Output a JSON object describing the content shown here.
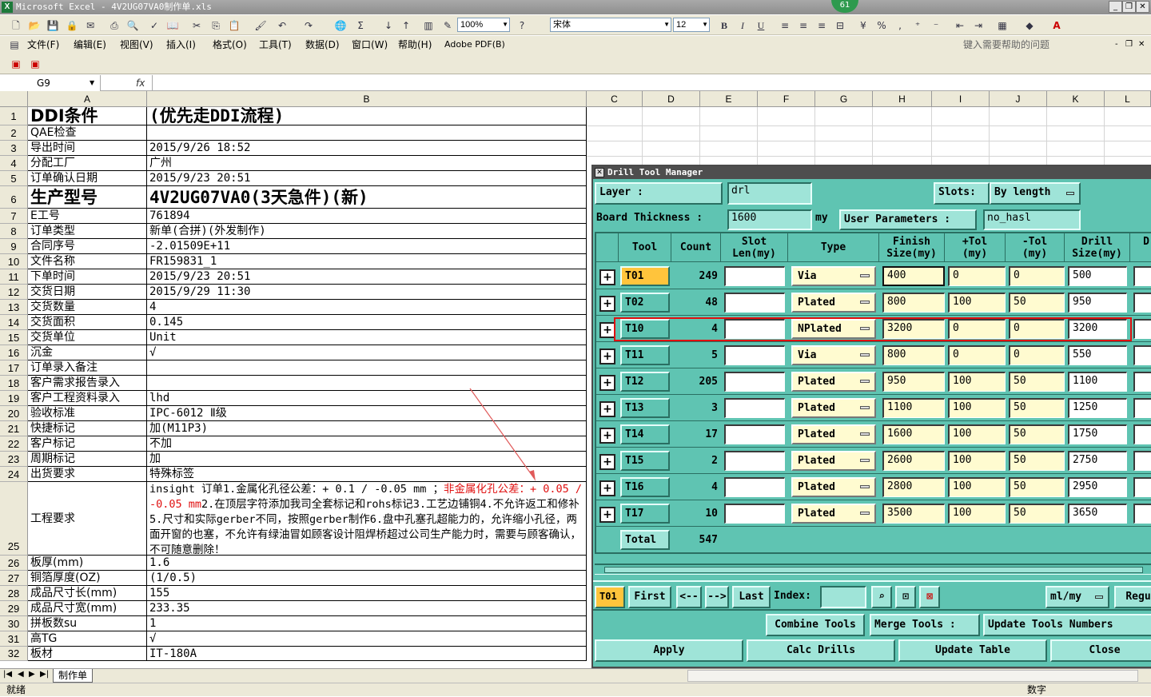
{
  "app": {
    "title": "Microsoft Excel - 4V2UG07VA0制作单.xls",
    "notification_count": "61"
  },
  "toolbar": {
    "zoom": "100%",
    "font_name": "宋体",
    "font_size": "12"
  },
  "menu": {
    "items": [
      "文件(F)",
      "编辑(E)",
      "视图(V)",
      "插入(I)",
      "格式(O)",
      "工具(T)",
      "数据(D)",
      "窗口(W)",
      "帮助(H)",
      "Adobe PDF(B)"
    ],
    "help_placeholder": "键入需要帮助的问题"
  },
  "formula_bar": {
    "name_box": "G9",
    "fx": "fx",
    "content": ""
  },
  "columns": [
    "A",
    "B",
    "C",
    "D",
    "E",
    "F",
    "G",
    "H",
    "I",
    "J",
    "K",
    "L"
  ],
  "rows": [
    {
      "n": "1",
      "a": "DDI条件",
      "b": "(优先走DDI流程)"
    },
    {
      "n": "2",
      "a": "QAE检查",
      "b": ""
    },
    {
      "n": "3",
      "a": "导出时间",
      "b": "2015/9/26 18:52"
    },
    {
      "n": "4",
      "a": "分配工厂",
      "b": "广州"
    },
    {
      "n": "5",
      "a": "订单确认日期",
      "b": "2015/9/23 20:51"
    },
    {
      "n": "6",
      "a": "生产型号",
      "b": "4V2UG07VA0(3天急件)(新)"
    },
    {
      "n": "7",
      "a": "E工号",
      "b": "761894"
    },
    {
      "n": "8",
      "a": "订单类型",
      "b": "新单(合拼)(外发制作)"
    },
    {
      "n": "9",
      "a": "合同序号",
      "b": "-2.01509E+11"
    },
    {
      "n": "10",
      "a": "文件名称",
      "b": "FR159831_1"
    },
    {
      "n": "11",
      "a": "下单时间",
      "b": "2015/9/23 20:51"
    },
    {
      "n": "12",
      "a": "交货日期",
      "b": "2015/9/29 11:30"
    },
    {
      "n": "13",
      "a": "交货数量",
      "b": "4"
    },
    {
      "n": "14",
      "a": "交货面积",
      "b": "0.145"
    },
    {
      "n": "15",
      "a": "交货单位",
      "b": "Unit"
    },
    {
      "n": "16",
      "a": "沉金",
      "b": "√"
    },
    {
      "n": "17",
      "a": "订单录入备注",
      "b": ""
    },
    {
      "n": "18",
      "a": "客户需求报告录入",
      "b": ""
    },
    {
      "n": "19",
      "a": "客户工程资料录入",
      "b": "lhd"
    },
    {
      "n": "20",
      "a": "验收标准",
      "b": "IPC-6012 Ⅱ级"
    },
    {
      "n": "21",
      "a": "快捷标记",
      "b": "加(M11P3)"
    },
    {
      "n": "22",
      "a": "客户标记",
      "b": "不加"
    },
    {
      "n": "23",
      "a": "周期标记",
      "b": "加"
    },
    {
      "n": "24",
      "a": "出货要求",
      "b": "特殊标签"
    },
    {
      "n": "25",
      "a": "工程要求",
      "b": ""
    },
    {
      "n": "26",
      "a": "板厚(mm)",
      "b": "1.6"
    },
    {
      "n": "27",
      "a": "铜箔厚度(OZ)",
      "b": " (1/0.5)"
    },
    {
      "n": "28",
      "a": "成品尺寸长(mm)",
      "b": "155"
    },
    {
      "n": "29",
      "a": "成品尺寸宽(mm)",
      "b": "233.35"
    },
    {
      "n": "30",
      "a": "拼板数su",
      "b": "1"
    },
    {
      "n": "31",
      "a": "高TG",
      "b": "√"
    },
    {
      "n": "32",
      "a": "板材",
      "b": "IT-180A"
    }
  ],
  "engineering_req": {
    "part1": "insight 订单1.金属化孔径公差：+ 0.1 / -0.05 mm ；",
    "part_red": "非金属化孔公差：+ 0.05 / -0.05 mm",
    "part2": "2.在顶层字符添加我司全套标记和rohs标记3.工艺边铺铜4.不允许返工和修补5.尺寸和实际gerber不同，按照gerber制作6.盘中孔塞孔超能力的，允许缩小孔径，两面开窗的也塞，不允许有绿油冒如顾客设计阻焊桥超过公司生产能力时，需要与顾客确认，不可随意删除！"
  },
  "sheet_tab": "制作单",
  "status": {
    "left": "就绪",
    "right": "数字"
  },
  "dialog": {
    "title": "Drill Tool Manager",
    "layer_label": "Layer              :",
    "layer_value": "drl",
    "slots_label": "Slots:",
    "slots_value": "By length",
    "thickness_label": "Board Thickness  :",
    "thickness_value": "1600",
    "thickness_unit": "my",
    "user_params_label": "User Parameters  :",
    "user_params_value": "no_hasl",
    "headers": [
      "Tool",
      "Count",
      "Slot\nLen(my)",
      "Type",
      "Finish\nSize(my)",
      "+Tol\n(my)",
      "-Tol\n(my)",
      "Drill\nSize(my)",
      "D"
    ],
    "tools": [
      {
        "tool": "T01",
        "count": "249",
        "type": "Via",
        "finish": "400",
        "ptol": "0",
        "ntol": "0",
        "drill": "500"
      },
      {
        "tool": "T02",
        "count": "48",
        "type": "Plated",
        "finish": "800",
        "ptol": "100",
        "ntol": "50",
        "drill": "950"
      },
      {
        "tool": "T10",
        "count": "4",
        "type": "NPlated",
        "finish": "3200",
        "ptol": "0",
        "ntol": "0",
        "drill": "3200"
      },
      {
        "tool": "T11",
        "count": "5",
        "type": "Via",
        "finish": "800",
        "ptol": "0",
        "ntol": "0",
        "drill": "550"
      },
      {
        "tool": "T12",
        "count": "205",
        "type": "Plated",
        "finish": "950",
        "ptol": "100",
        "ntol": "50",
        "drill": "1100"
      },
      {
        "tool": "T13",
        "count": "3",
        "type": "Plated",
        "finish": "1100",
        "ptol": "100",
        "ntol": "50",
        "drill": "1250"
      },
      {
        "tool": "T14",
        "count": "17",
        "type": "Plated",
        "finish": "1600",
        "ptol": "100",
        "ntol": "50",
        "drill": "1750"
      },
      {
        "tool": "T15",
        "count": "2",
        "type": "Plated",
        "finish": "2600",
        "ptol": "100",
        "ntol": "50",
        "drill": "2750"
      },
      {
        "tool": "T16",
        "count": "4",
        "type": "Plated",
        "finish": "2800",
        "ptol": "100",
        "ntol": "50",
        "drill": "2950"
      },
      {
        "tool": "T17",
        "count": "10",
        "type": "Plated",
        "finish": "3500",
        "ptol": "100",
        "ntol": "50",
        "drill": "3650"
      }
    ],
    "total_label": "Total",
    "total_count": "547",
    "current_tool": "T01",
    "nav": {
      "first": "First",
      "prev": "<--",
      "next": "-->",
      "last": "Last",
      "index_label": "Index:"
    },
    "units_value": "ml/my",
    "regu_label": "Regu",
    "combine": "Combine Tools",
    "merge": "Merge Tools  :",
    "update_numbers": "Update Tools Numbers",
    "apply": "Apply",
    "calc": "Calc Drills",
    "update_table": "Update Table",
    "close": "Close"
  },
  "colors": {
    "dialog_bg": "#5fc4b2",
    "tool_orange": "#ffc43c",
    "highlight_red": "#e01010",
    "input_yellow": "#fffbd0"
  }
}
